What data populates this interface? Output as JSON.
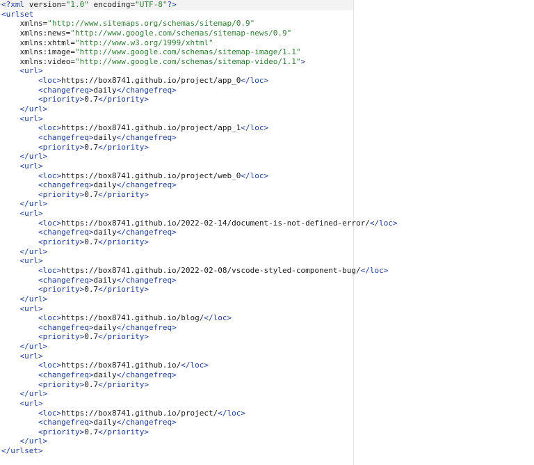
{
  "declaration": {
    "open": "<?",
    "tag": "xml",
    "attr1_name": "version",
    "attr1_value": "\"1.0\"",
    "attr2_name": "encoding",
    "attr2_value": "\"UTF-8\"",
    "close": "?>"
  },
  "urlset_open": "<urlset",
  "namespaces": [
    {
      "name": "xmlns",
      "value": "\"http://www.sitemaps.org/schemas/sitemap/0.9\""
    },
    {
      "name": "xmlns:news",
      "value": "\"http://www.google.com/schemas/sitemap-news/0.9\""
    },
    {
      "name": "xmlns:xhtml",
      "value": "\"http://www.w3.org/1999/xhtml\""
    },
    {
      "name": "xmlns:image",
      "value": "\"http://www.google.com/schemas/sitemap-image/1.1\""
    },
    {
      "name": "xmlns:video",
      "value": "\"http://www.google.com/schemas/sitemap-video/1.1\""
    }
  ],
  "namespaces_close": ">",
  "urls": [
    {
      "loc": "https://box8741.github.io/project/app_0",
      "changefreq": "daily",
      "priority": "0.7"
    },
    {
      "loc": "https://box8741.github.io/project/app_1",
      "changefreq": "daily",
      "priority": "0.7"
    },
    {
      "loc": "https://box8741.github.io/project/web_0",
      "changefreq": "daily",
      "priority": "0.7"
    },
    {
      "loc": "https://box8741.github.io/2022-02-14/document-is-not-defined-error/",
      "changefreq": "daily",
      "priority": "0.7"
    },
    {
      "loc": "https://box8741.github.io/2022-02-08/vscode-styled-component-bug/",
      "changefreq": "daily",
      "priority": "0.7"
    },
    {
      "loc": "https://box8741.github.io/blog/",
      "changefreq": "daily",
      "priority": "0.7"
    },
    {
      "loc": "https://box8741.github.io/",
      "changefreq": "daily",
      "priority": "0.7"
    },
    {
      "loc": "https://box8741.github.io/project/",
      "changefreq": "daily",
      "priority": "0.7"
    }
  ],
  "tags": {
    "url_open": "<url>",
    "url_close": "</url>",
    "loc_open": "<loc>",
    "loc_close": "</loc>",
    "changefreq_open": "<changefreq>",
    "changefreq_close": "</changefreq>",
    "priority_open": "<priority>",
    "priority_close": "</priority>"
  },
  "urlset_close": "</urlset>"
}
